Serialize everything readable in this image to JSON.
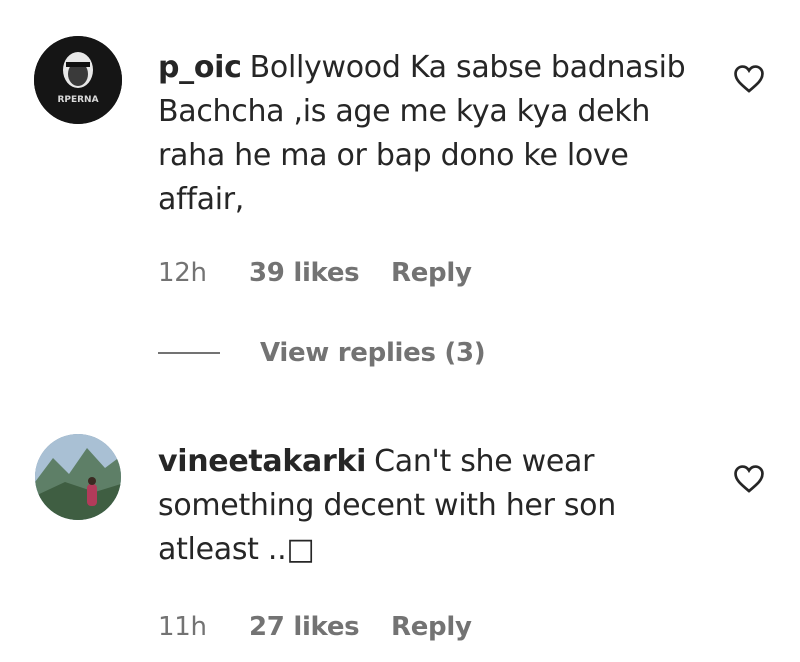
{
  "comments": [
    {
      "username": "p_oic",
      "text": "Bollywood Ka sabse badnasib Bachcha ,is age me kya kya dekh raha he ma or bap dono ke love affair,",
      "time": "12h",
      "likes": "39 likes",
      "reply": "Reply",
      "avatar_text": "RPERNA",
      "view_replies": "View replies (3)"
    },
    {
      "username": "vineetakarki",
      "text": "Can't she wear something decent with her son atleast ..□",
      "time": "11h",
      "likes": "27 likes",
      "reply": "Reply"
    }
  ],
  "icons": {
    "like": "heart-outline-icon"
  }
}
